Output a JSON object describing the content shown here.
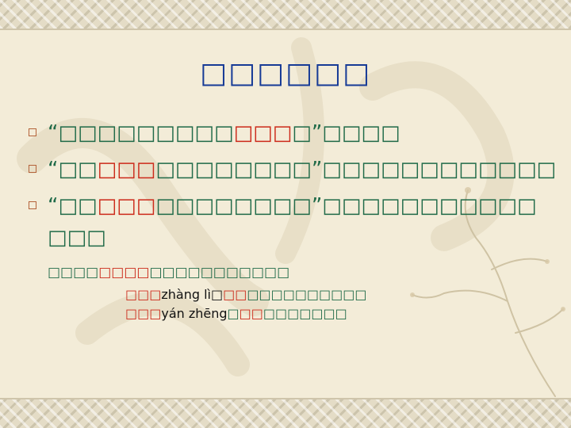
{
  "title": "□□□□□□",
  "lines": [
    {
      "parts": [
        "“□□□□□□□□□",
        "□□□",
        "□”□□□□"
      ]
    },
    {
      "parts": [
        "“□□",
        "□□□",
        "□□□□□□□□”□□□□□□□□□□□□"
      ]
    },
    {
      "parts": [
        "“□□",
        "□□□",
        "□□□□□□□□”□□□□□□□□□□□"
      ]
    }
  ],
  "line3_wrap": "□□□",
  "sub1": {
    "a": "□□□□",
    "hl": "□□□□",
    "b": "□□□□□□□□□□□"
  },
  "sub2": {
    "hl1": "□□□",
    "pinyin": "zhàng lì",
    "b": "□",
    "hl2": "□□",
    "c": "□□□□□□□□□□"
  },
  "sub3": {
    "hl1": "□□□",
    "pinyin": "yán zhēng",
    "b": "□",
    "hl2": "□□",
    "c": "□□□□□□□"
  }
}
